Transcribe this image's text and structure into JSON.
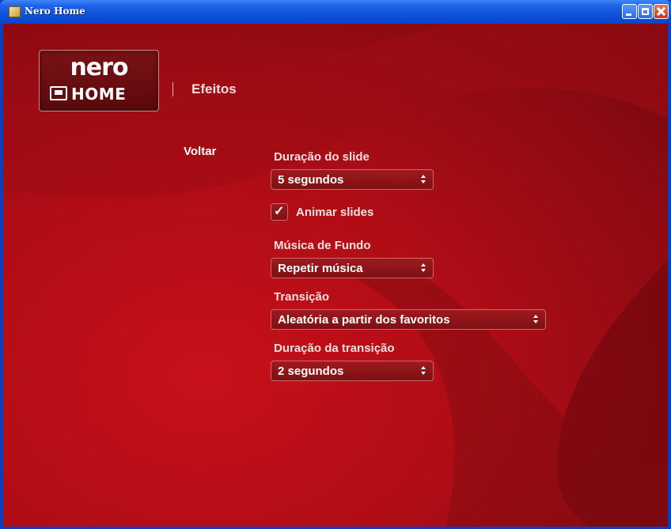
{
  "window": {
    "title": "Nero Home"
  },
  "logo": {
    "brand": "nero",
    "product": "HOME"
  },
  "header": {
    "page_title": "Efeitos"
  },
  "nav": {
    "back_label": "Voltar"
  },
  "settings": {
    "slide_duration": {
      "label": "Duração do slide",
      "value": "5 segundos"
    },
    "animate_slides": {
      "label": "Animar slides",
      "checked": true,
      "check_glyph": "✓"
    },
    "background_music": {
      "label": "Música de Fundo",
      "value": "Repetir música"
    },
    "transition": {
      "label": "Transição",
      "value": "Aleatória a partir dos favoritos"
    },
    "transition_duration": {
      "label": "Duração da transição",
      "value": "2 segundos"
    }
  },
  "colors": {
    "background_red": "#b00d16",
    "dark_red": "#700810",
    "titlebar_blue": "#0c4fd7"
  }
}
